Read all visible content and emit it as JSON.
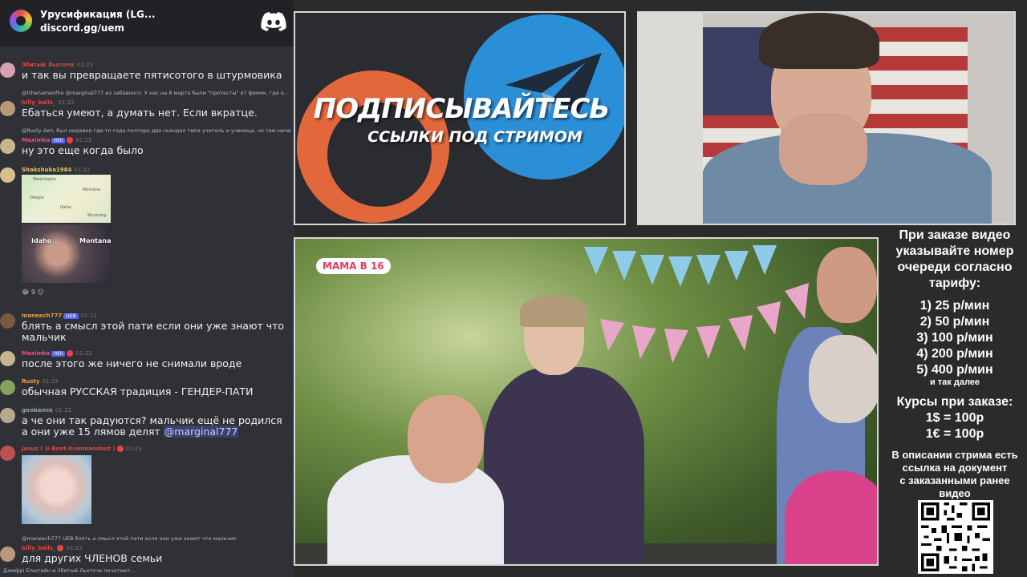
{
  "server": {
    "name": "Урусификация (LG...",
    "invite": "discord.gg/uem"
  },
  "messages": [
    {
      "user": "Збитый Льоточк",
      "time": "01:22",
      "text": "и так вы превращаете пятисотого в штурмовика",
      "color": "#e0443e"
    },
    {
      "reply": "@tthenameofhe @marginal777 из забавного. У нас на 8 марта были \"протесты\" от фемок, где о..."
    },
    {
      "user": "billy_balls_",
      "time": "01:22",
      "text": "Ебаться умеют, а думать нет. Если вкратце.",
      "color": "#e0443e"
    },
    {
      "reply": "@Rusty йеп, был недавно где-то года полтора два скандал типа учитель и ученица, но там ничег"
    },
    {
      "user": "Maximka",
      "badge": "HOI",
      "time": "01:22",
      "text": "ну это еще когда было",
      "color": "#f04f7a"
    },
    {
      "user": "Shakshuka1984",
      "time": "01:22",
      "color": "#e8c26a"
    },
    {
      "reactions": "😂 9  😐"
    },
    {
      "user": "maneech777",
      "badge": "UEB",
      "time": "01:22",
      "text": "блять а смысл этой пати если они уже знают что мальчик",
      "color": "#e9a33c"
    },
    {
      "user": "Maximka",
      "badge": "HOI",
      "time": "01:23",
      "text": "после этого же ничего не снимали вроде",
      "color": "#f04f7a"
    },
    {
      "user": "Rusty",
      "time": "01:23",
      "text": "обычная РУССКАЯ традиция - ГЕНДЕР-ПАТИ",
      "color": "#e9a33c"
    },
    {
      "user": "goobamie",
      "time": "01:23",
      "text": "а че они так радуются? мальчик ещё не родился а они уже 15 лямов делят",
      "mention": "@marginal777",
      "color": "#9aa0a6"
    },
    {
      "user": "Jesus ( U-Boot-Kommandant )",
      "time": "01:23",
      "color": "#e0443e"
    },
    {
      "reply": "@maneech777 UEB блять а смысл этой пати если они уже знают что мальчик"
    },
    {
      "user": "billy_balls_",
      "time": "01:23",
      "text": "для других ЧЛЕНОВ семьи",
      "color": "#e0443e"
    }
  ],
  "map_labels": [
    "Washington",
    "Montana",
    "Oregon",
    "Idaho",
    "Wyoming"
  ],
  "photo_labels": [
    "Idaho",
    "Montana"
  ],
  "typing": "Джефрі Епштейн и Збитый Льоточк печатают...",
  "banner": {
    "title": "ПОДПИСЫВАЙТЕСЬ",
    "subtitle": "ССЫЛКИ ПОД СТРИМОМ"
  },
  "video": {
    "badge": "МАМА В 16"
  },
  "info": {
    "line1": "При заказе видео",
    "line2": "указывайте номер",
    "line3": "очереди согласно",
    "line4": "тарифу:",
    "rates": [
      "1) 25 р/мин",
      "2) 50 р/мин",
      "3) 100 р/мин",
      "4) 200 р/мин",
      "5) 400 р/мин"
    ],
    "etc": "и так далее",
    "courses_title": "Курсы при заказе:",
    "course1": "1$ = 100р",
    "course2": "1€ = 100р",
    "desc1": "В описании стрима есть",
    "desc2": "ссылка на документ",
    "desc3": "с заказанными ранее",
    "desc4": "видео"
  },
  "colors": {
    "discord_bg": "#2f3136",
    "patreon": "#e2683c",
    "telegram": "#2b8fd8",
    "mention": "#c9cdfb"
  }
}
